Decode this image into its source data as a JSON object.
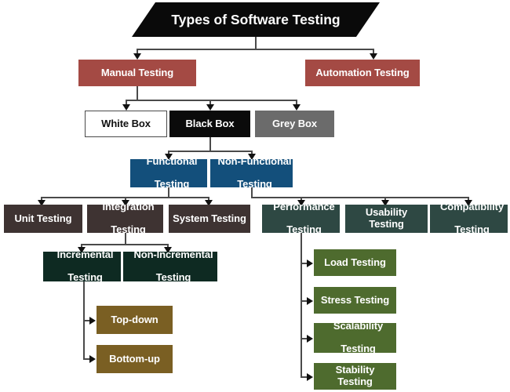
{
  "diagram": {
    "title": "Types of Software Testing",
    "colors": {
      "title_bg": "#0a0a0a",
      "manual_automation": "#a44a44",
      "white_box": "#ffffff",
      "black_box": "#0b0b0b",
      "grey_box": "#6b6b6b",
      "functional": "#134f7b",
      "functional_children": "#3e3332",
      "nonfunctional_children": "#2e4843",
      "incremental": "#0e2a22",
      "topdown_bottomup": "#7a5f23",
      "performance_children": "#4e6b2e",
      "connector": "#4a4a4a",
      "arrow": "#111111"
    },
    "level1": [
      {
        "id": "manual",
        "label": "Manual Testing"
      },
      {
        "id": "automation",
        "label": "Automation Testing"
      }
    ],
    "level2": [
      {
        "id": "white-box",
        "label": "White Box"
      },
      {
        "id": "black-box",
        "label": "Black Box"
      },
      {
        "id": "grey-box",
        "label": "Grey Box"
      }
    ],
    "level3": [
      {
        "id": "functional",
        "line1": "Functional",
        "line2": "Testing"
      },
      {
        "id": "non-functional",
        "line1": "Non-Functional",
        "line2": "Testing"
      }
    ],
    "functional_children": [
      {
        "id": "unit-testing",
        "line1": "Unit Testing",
        "line2": ""
      },
      {
        "id": "integration-testing",
        "line1": "Integration",
        "line2": "Testing"
      },
      {
        "id": "system-testing",
        "line1": "System Testing",
        "line2": ""
      }
    ],
    "nonfunctional_children": [
      {
        "id": "performance-testing",
        "line1": "Performance",
        "line2": "Testing"
      },
      {
        "id": "usability-testing",
        "line1": "Usability Testing",
        "line2": ""
      },
      {
        "id": "compatibility-testing",
        "line1": "Compatibility",
        "line2": "Testing"
      }
    ],
    "integration_children": [
      {
        "id": "incremental-testing",
        "line1": "Incremental",
        "line2": "Testing"
      },
      {
        "id": "non-incremental-testing",
        "line1": "Non-Incremental",
        "line2": "Testing"
      }
    ],
    "incremental_children": [
      {
        "id": "top-down",
        "label": "Top-down"
      },
      {
        "id": "bottom-up",
        "label": "Bottom-up"
      }
    ],
    "performance_children": [
      {
        "id": "load-testing",
        "line1": "Load Testing",
        "line2": ""
      },
      {
        "id": "stress-testing",
        "line1": "Stress Testing",
        "line2": ""
      },
      {
        "id": "scalability-testing",
        "line1": "Scalability",
        "line2": "Testing"
      },
      {
        "id": "stability-testing",
        "line1": "Stability Testing",
        "line2": ""
      }
    ]
  }
}
